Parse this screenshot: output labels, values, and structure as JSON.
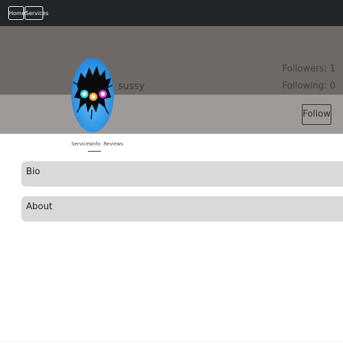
{
  "navbar": {
    "home_label": "Home",
    "services_label": "Services"
  },
  "profile": {
    "username": "sussy",
    "followers": "Followers: 1",
    "following": "Following: 0",
    "follow_label": "Follow"
  },
  "tabs": {
    "services": "Services",
    "info": "Info",
    "reviews": "Reviews",
    "active": "Info"
  },
  "sections": {
    "bio": "Bio",
    "about": "About"
  },
  "colors": {
    "navbar": "#212429",
    "banner_top": "#6e6966",
    "banner_bottom": "#9e9a98",
    "card": "#d9d9d9",
    "avatar_blue": "#2f97e8"
  },
  "icons": {
    "avatar": "cracked-egg-creature-avatar"
  }
}
